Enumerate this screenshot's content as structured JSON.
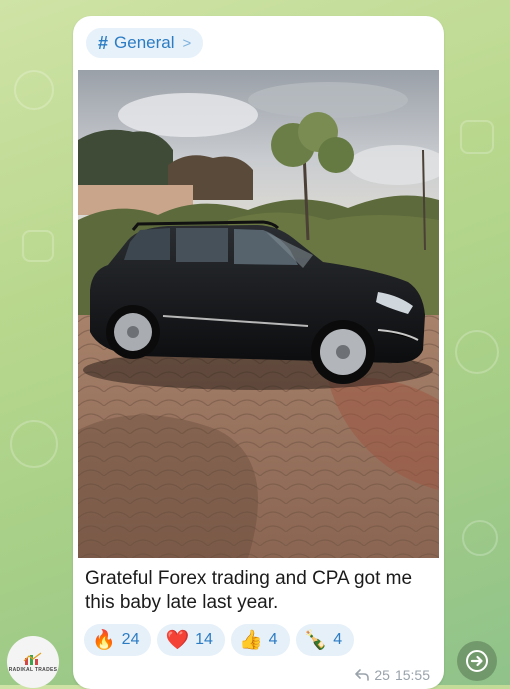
{
  "post": {
    "topic_label": "General",
    "caption": "Grateful Forex trading and CPA got me this baby late last year.",
    "reactions": [
      {
        "emoji": "🔥",
        "count": "24",
        "icon": "fire-icon"
      },
      {
        "emoji": "❤️",
        "count": "14",
        "icon": "heart-icon"
      },
      {
        "emoji": "👍",
        "count": "4",
        "icon": "thumbs-up-icon"
      },
      {
        "emoji": "🍾",
        "count": "4",
        "icon": "champagne-icon"
      }
    ],
    "views": "25",
    "time": "15:55"
  },
  "channel": {
    "avatar_text": "RADIKAL TRADES"
  },
  "colors": {
    "accent": "#2c7cc4",
    "reaction_bg": "#e6f0f9",
    "wallpaper": "#b9d88e"
  }
}
